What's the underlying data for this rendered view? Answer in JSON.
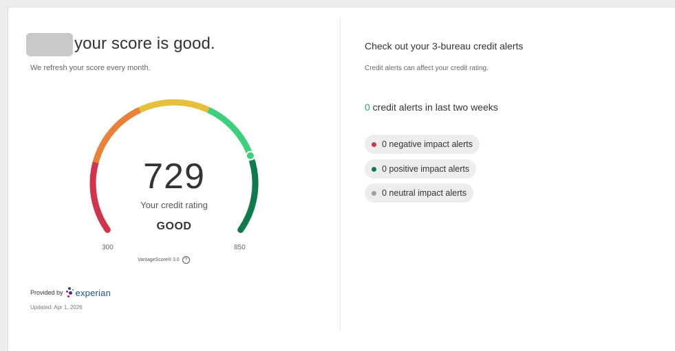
{
  "score_panel": {
    "headline": "your score is good.",
    "subtext": "We refresh your score every month.",
    "score": "729",
    "rating_label": "Your credit rating",
    "rating": "GOOD",
    "min": "300",
    "max": "850",
    "model": "VantageScore® 3.0",
    "score_range": [
      300,
      850
    ],
    "provided_by": "Provided by",
    "provider": "experian",
    "updated": "Updated: Apr 1, 2026"
  },
  "alerts_panel": {
    "title": "Check out your 3-bureau credit alerts",
    "subtitle": "Credit alerts can affect your credit rating.",
    "count": "0",
    "count_suffix": " credit alerts in last two weeks",
    "items": [
      {
        "label": "0 negative impact alerts",
        "color": "#d1344b"
      },
      {
        "label": "0 positive impact alerts",
        "color": "#0f7a4a"
      },
      {
        "label": "0 neutral impact alerts",
        "color": "#9aa0ad"
      }
    ]
  },
  "gauge_colors": [
    "#d1344b",
    "#e8813a",
    "#e6c03a",
    "#3ecf7c",
    "#0f7a4a"
  ]
}
